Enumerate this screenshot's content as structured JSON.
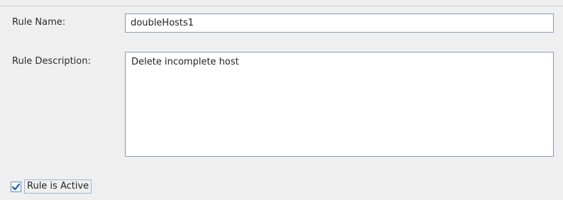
{
  "form": {
    "rule_name_label": "Rule Name:",
    "rule_name_value": "doubleHosts1",
    "rule_description_label": "Rule Description:",
    "rule_description_value": "Delete incomplete host",
    "active_label": "Rule is Active",
    "active_checked": true
  },
  "colors": {
    "background": "#efefef",
    "field_border": "#7f9db9",
    "check_color": "#1b5fb5"
  },
  "icons": {
    "checkbox": "check-icon"
  }
}
